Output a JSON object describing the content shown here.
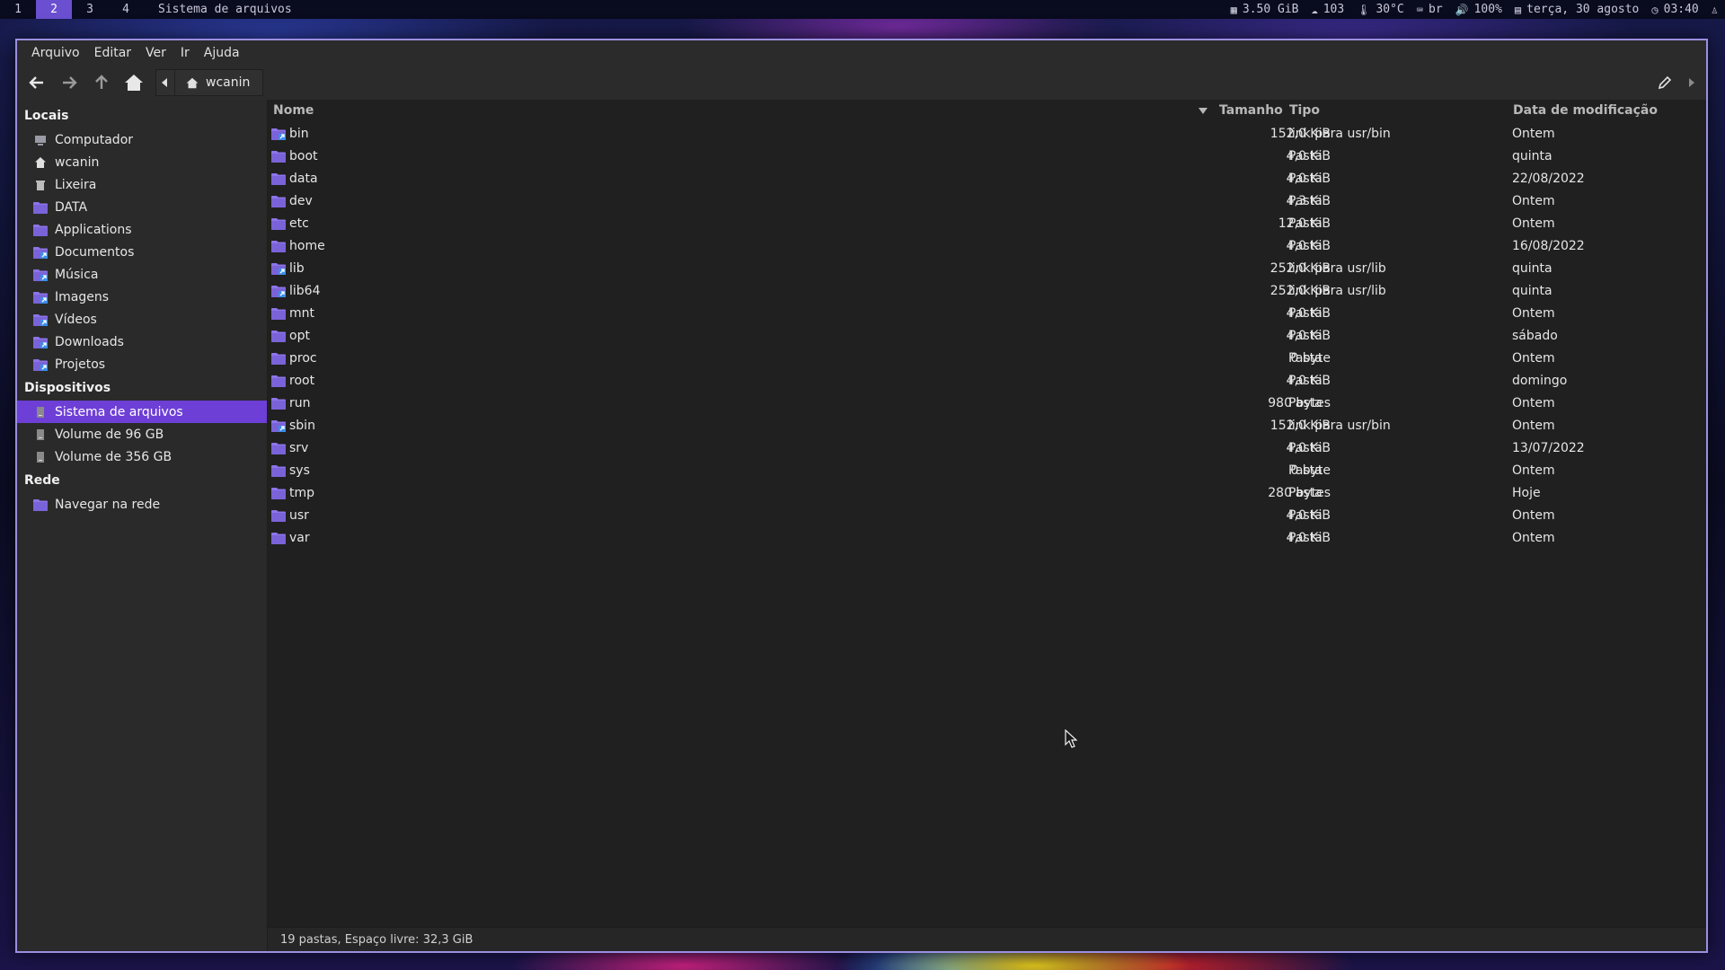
{
  "topbar": {
    "workspaces": [
      "1",
      "2",
      "3",
      "4"
    ],
    "active_workspace": "2",
    "window_title": "Sistema de arquivos",
    "memory": "3.50 GiB",
    "updates": "103",
    "temperature": "30°C",
    "keyboard_layout": "br",
    "volume": "100%",
    "date": "terça, 30 agosto",
    "time": "03:40"
  },
  "menubar": [
    "Arquivo",
    "Editar",
    "Ver",
    "Ir",
    "Ajuda"
  ],
  "toolbar": {
    "location": "wcanin"
  },
  "sidebar": {
    "sections": [
      {
        "title": "Locais",
        "items": [
          {
            "label": "Computador",
            "icon": "computer-icon"
          },
          {
            "label": "wcanin",
            "icon": "home-icon"
          },
          {
            "label": "Lixeira",
            "icon": "trash-icon"
          },
          {
            "label": "DATA",
            "icon": "folder-icon"
          },
          {
            "label": "Applications",
            "icon": "folder-icon"
          },
          {
            "label": "Documentos",
            "icon": "folder-link-icon"
          },
          {
            "label": "Música",
            "icon": "folder-link-icon"
          },
          {
            "label": "Imagens",
            "icon": "folder-link-icon"
          },
          {
            "label": "Vídeos",
            "icon": "folder-link-icon"
          },
          {
            "label": "Downloads",
            "icon": "folder-link-icon"
          },
          {
            "label": "Projetos",
            "icon": "folder-link-icon"
          }
        ]
      },
      {
        "title": "Dispositivos",
        "items": [
          {
            "label": "Sistema de arquivos",
            "icon": "drive-icon",
            "selected": true
          },
          {
            "label": "Volume de 96 GB",
            "icon": "drive-icon"
          },
          {
            "label": "Volume de 356 GB",
            "icon": "drive-icon"
          }
        ]
      },
      {
        "title": "Rede",
        "items": [
          {
            "label": "Navegar na rede",
            "icon": "network-icon"
          }
        ]
      }
    ]
  },
  "columns": {
    "name": "Nome",
    "size": "Tamanho",
    "type": "Tipo",
    "date": "Data de modificação"
  },
  "files": [
    {
      "name": "bin",
      "size": "152,0 KiB",
      "type": "link para usr/bin",
      "date": "Ontem",
      "link": true
    },
    {
      "name": "boot",
      "size": "4,0 KiB",
      "type": "Pasta",
      "date": "quinta",
      "link": false
    },
    {
      "name": "data",
      "size": "4,0 KiB",
      "type": "Pasta",
      "date": "22/08/2022",
      "link": false
    },
    {
      "name": "dev",
      "size": "4,3 KiB",
      "type": "Pasta",
      "date": "Ontem",
      "link": false
    },
    {
      "name": "etc",
      "size": "12,0 KiB",
      "type": "Pasta",
      "date": "Ontem",
      "link": false
    },
    {
      "name": "home",
      "size": "4,0 KiB",
      "type": "Pasta",
      "date": "16/08/2022",
      "link": false
    },
    {
      "name": "lib",
      "size": "252,0 KiB",
      "type": "link para usr/lib",
      "date": "quinta",
      "link": true
    },
    {
      "name": "lib64",
      "size": "252,0 KiB",
      "type": "link para usr/lib",
      "date": "quinta",
      "link": true
    },
    {
      "name": "mnt",
      "size": "4,0 KiB",
      "type": "Pasta",
      "date": "Ontem",
      "link": false
    },
    {
      "name": "opt",
      "size": "4,0 KiB",
      "type": "Pasta",
      "date": "sábado",
      "link": false
    },
    {
      "name": "proc",
      "size": "0 byte",
      "type": "Pasta",
      "date": "Ontem",
      "link": false
    },
    {
      "name": "root",
      "size": "4,0 KiB",
      "type": "Pasta",
      "date": "domingo",
      "link": false
    },
    {
      "name": "run",
      "size": "980 bytes",
      "type": "Pasta",
      "date": "Ontem",
      "link": false
    },
    {
      "name": "sbin",
      "size": "152,0 KiB",
      "type": "link para usr/bin",
      "date": "Ontem",
      "link": true
    },
    {
      "name": "srv",
      "size": "4,0 KiB",
      "type": "Pasta",
      "date": "13/07/2022",
      "link": false
    },
    {
      "name": "sys",
      "size": "0 byte",
      "type": "Pasta",
      "date": "Ontem",
      "link": false
    },
    {
      "name": "tmp",
      "size": "280 bytes",
      "type": "Pasta",
      "date": "Hoje",
      "link": false
    },
    {
      "name": "usr",
      "size": "4,0 KiB",
      "type": "Pasta",
      "date": "Ontem",
      "link": false
    },
    {
      "name": "var",
      "size": "4,0 KiB",
      "type": "Pasta",
      "date": "Ontem",
      "link": false
    }
  ],
  "status": "19 pastas, Espaço livre: 32,3 GiB",
  "colors": {
    "accent": "#6e3fd6",
    "window_border": "#9b8fe0",
    "workspace_active": "#6a4fd0",
    "folder": "#8d74e8"
  }
}
